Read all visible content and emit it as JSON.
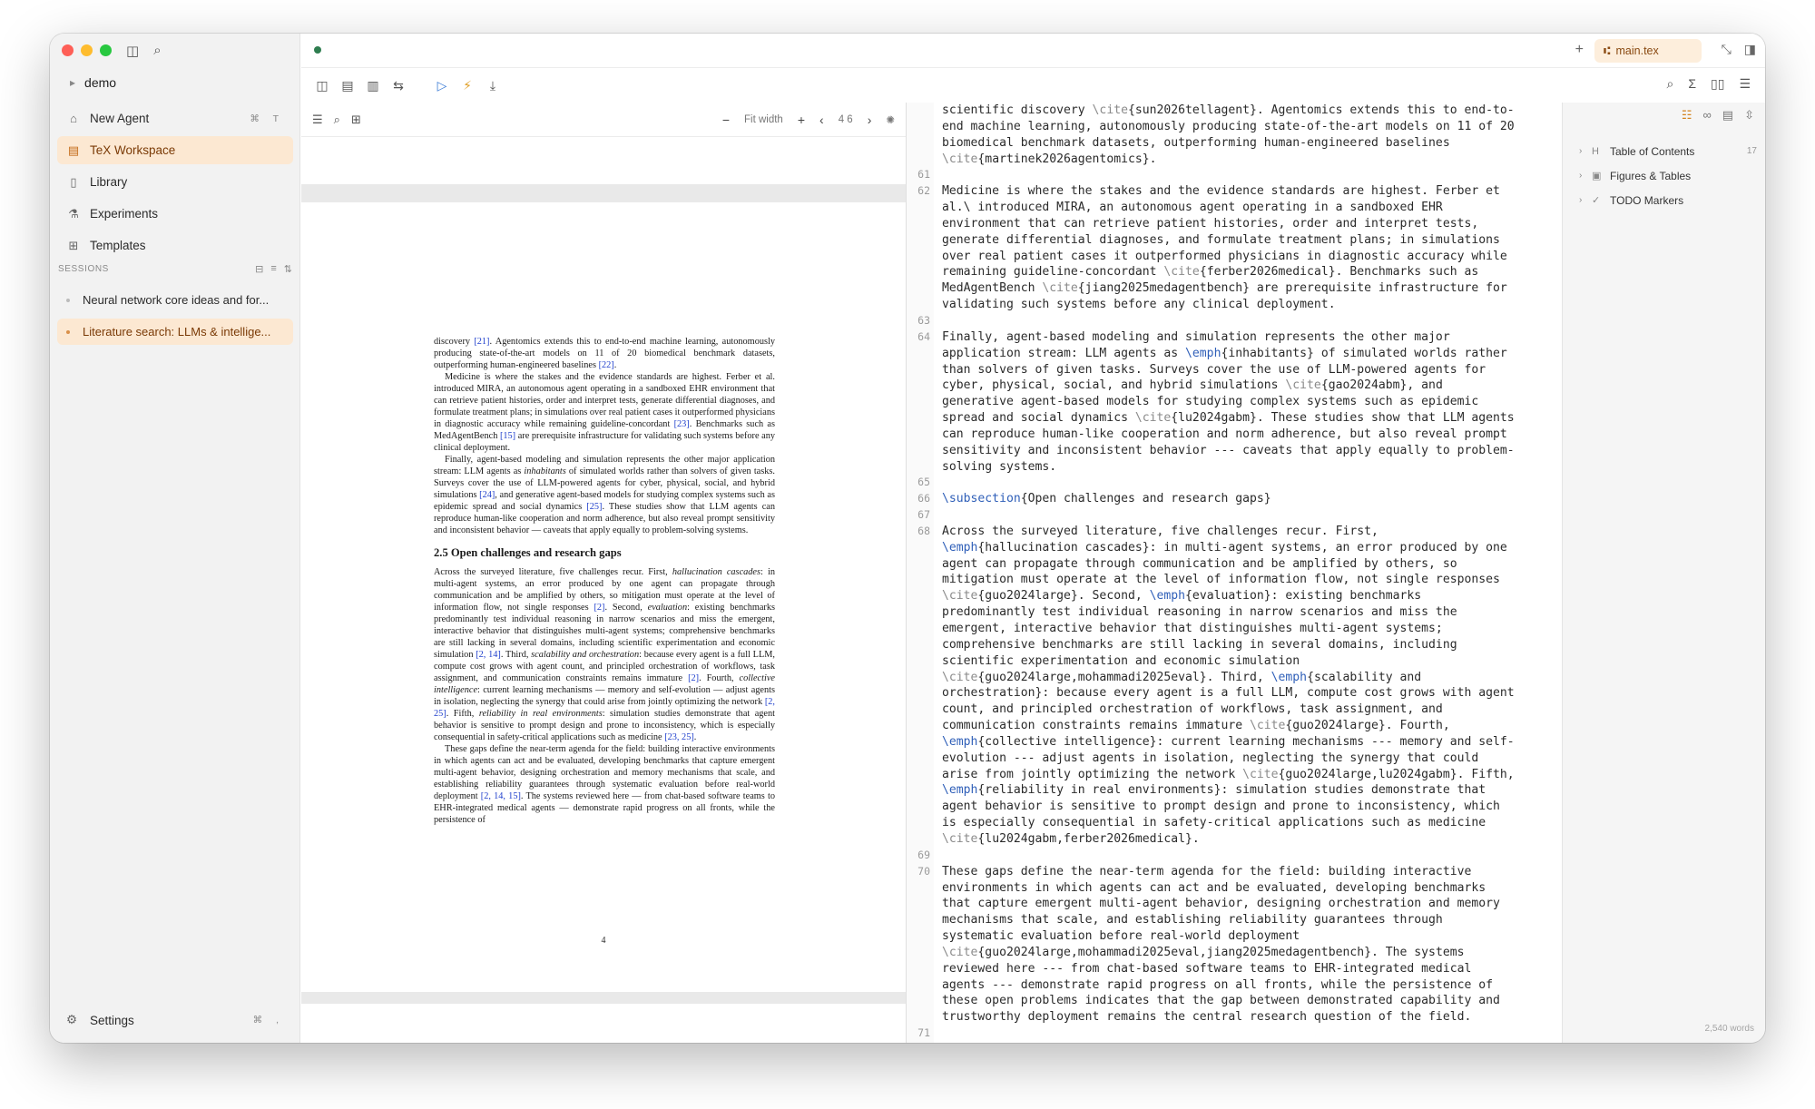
{
  "sidebar": {
    "workspace": "demo",
    "nav": [
      {
        "label": "New Agent",
        "icon": "agent-icon",
        "shortcut": "⌘ T"
      },
      {
        "label": "TeX Workspace",
        "icon": "tex-icon",
        "active": true
      },
      {
        "label": "Library",
        "icon": "library-icon"
      },
      {
        "label": "Experiments",
        "icon": "flask-icon"
      },
      {
        "label": "Templates",
        "icon": "templates-icon"
      }
    ],
    "sessions_header": "SESSIONS",
    "sessions": [
      {
        "label": "Neural network core ideas and for..."
      },
      {
        "label": "Literature search: LLMs & intellige...",
        "active": true
      }
    ],
    "settings_label": "Settings",
    "settings_shortcut": "⌘ ,"
  },
  "titlebar": {
    "file_tab": "main.tex"
  },
  "pdf": {
    "zoom_label": "Fit width",
    "page_indicator": "4 6",
    "page_number": "4",
    "section_heading": "2.5   Open challenges and research gaps"
  },
  "source": {
    "lines": [
      {
        "n": "",
        "t": "scientific discovery \\cite{sun2026tellagent}. Agentomics extends this to end-to-"
      },
      {
        "n": "",
        "t": "end machine learning, autonomously producing state-of-the-art models on 11 of 20"
      },
      {
        "n": "",
        "t": "biomedical benchmark datasets, outperforming human-engineered baselines"
      },
      {
        "n": "",
        "t": "\\cite{martinek2026agentomics}."
      },
      {
        "n": "61",
        "t": ""
      },
      {
        "n": "62",
        "t": "Medicine is where the stakes and the evidence standards are highest. Ferber et"
      },
      {
        "n": "",
        "t": "al.\\ introduced MIRA, an autonomous agent operating in a sandboxed EHR"
      },
      {
        "n": "",
        "t": "environment that can retrieve patient histories, order and interpret tests,"
      },
      {
        "n": "",
        "t": "generate differential diagnoses, and formulate treatment plans; in simulations"
      },
      {
        "n": "",
        "t": "over real patient cases it outperformed physicians in diagnostic accuracy while"
      },
      {
        "n": "",
        "t": "remaining guideline-concordant \\cite{ferber2026medical}. Benchmarks such as"
      },
      {
        "n": "",
        "t": "MedAgentBench \\cite{jiang2025medagentbench} are prerequisite infrastructure for"
      },
      {
        "n": "",
        "t": "validating such systems before any clinical deployment."
      },
      {
        "n": "63",
        "t": ""
      },
      {
        "n": "64",
        "t": "Finally, agent-based modeling and simulation represents the other major"
      },
      {
        "n": "",
        "t": "application stream: LLM agents as \\emph{inhabitants} of simulated worlds rather"
      },
      {
        "n": "",
        "t": "than solvers of given tasks. Surveys cover the use of LLM-powered agents for"
      },
      {
        "n": "",
        "t": "cyber, physical, social, and hybrid simulations \\cite{gao2024abm}, and"
      },
      {
        "n": "",
        "t": "generative agent-based models for studying complex systems such as epidemic"
      },
      {
        "n": "",
        "t": "spread and social dynamics \\cite{lu2024gabm}. These studies show that LLM agents"
      },
      {
        "n": "",
        "t": "can reproduce human-like cooperation and norm adherence, but also reveal prompt"
      },
      {
        "n": "",
        "t": "sensitivity and inconsistent behavior --- caveats that apply equally to problem-"
      },
      {
        "n": "",
        "t": "solving systems."
      },
      {
        "n": "65",
        "t": ""
      },
      {
        "n": "66",
        "t": "\\subsection{Open challenges and research gaps}"
      },
      {
        "n": "67",
        "t": ""
      },
      {
        "n": "68",
        "t": "Across the surveyed literature, five challenges recur. First,"
      },
      {
        "n": "",
        "t": "\\emph{hallucination cascades}: in multi-agent systems, an error produced by one"
      },
      {
        "n": "",
        "t": "agent can propagate through communication and be amplified by others, so"
      },
      {
        "n": "",
        "t": "mitigation must operate at the level of information flow, not single responses"
      },
      {
        "n": "",
        "t": "\\cite{guo2024large}. Second, \\emph{evaluation}: existing benchmarks"
      },
      {
        "n": "",
        "t": "predominantly test individual reasoning in narrow scenarios and miss the"
      },
      {
        "n": "",
        "t": "emergent, interactive behavior that distinguishes multi-agent systems;"
      },
      {
        "n": "",
        "t": "comprehensive benchmarks are still lacking in several domains, including"
      },
      {
        "n": "",
        "t": "scientific experimentation and economic simulation"
      },
      {
        "n": "",
        "t": "\\cite{guo2024large,mohammadi2025eval}. Third, \\emph{scalability and"
      },
      {
        "n": "",
        "t": "orchestration}: because every agent is a full LLM, compute cost grows with agent"
      },
      {
        "n": "",
        "t": "count, and principled orchestration of workflows, task assignment, and"
      },
      {
        "n": "",
        "t": "communication constraints remains immature \\cite{guo2024large}. Fourth,"
      },
      {
        "n": "",
        "t": "\\emph{collective intelligence}: current learning mechanisms --- memory and self-"
      },
      {
        "n": "",
        "t": "evolution --- adjust agents in isolation, neglecting the synergy that could"
      },
      {
        "n": "",
        "t": "arise from jointly optimizing the network \\cite{guo2024large,lu2024gabm}. Fifth,"
      },
      {
        "n": "",
        "t": "\\emph{reliability in real environments}: simulation studies demonstrate that"
      },
      {
        "n": "",
        "t": "agent behavior is sensitive to prompt design and prone to inconsistency, which"
      },
      {
        "n": "",
        "t": "is especially consequential in safety-critical applications such as medicine"
      },
      {
        "n": "",
        "t": "\\cite{lu2024gabm,ferber2026medical}."
      },
      {
        "n": "69",
        "t": ""
      },
      {
        "n": "70",
        "t": "These gaps define the near-term agenda for the field: building interactive"
      },
      {
        "n": "",
        "t": "environments in which agents can act and be evaluated, developing benchmarks"
      },
      {
        "n": "",
        "t": "that capture emergent multi-agent behavior, designing orchestration and memory"
      },
      {
        "n": "",
        "t": "mechanisms that scale, and establishing reliability guarantees through"
      },
      {
        "n": "",
        "t": "systematic evaluation before real-world deployment"
      },
      {
        "n": "",
        "t": "\\cite{guo2024large,mohammadi2025eval,jiang2025medagentbench}. The systems"
      },
      {
        "n": "",
        "t": "reviewed here --- from chat-based software teams to EHR-integrated medical"
      },
      {
        "n": "",
        "t": "agents --- demonstrate rapid progress on all fronts, while the persistence of"
      },
      {
        "n": "",
        "t": "these open problems indicates that the gap between demonstrated capability and"
      },
      {
        "n": "",
        "t": "trustworthy deployment remains the central research question of the field."
      },
      {
        "n": "71",
        "t": ""
      }
    ]
  },
  "outline": {
    "items": [
      {
        "label": "Table of Contents",
        "icon": "heading-icon",
        "count": "17"
      },
      {
        "label": "Figures & Tables",
        "icon": "image-icon",
        "count": ""
      },
      {
        "label": "TODO Markers",
        "icon": "check-icon",
        "count": ""
      }
    ],
    "word_count": "2,540 words"
  },
  "colors": {
    "accent": "#fce8d2",
    "accent_text": "#7a3a06",
    "status": "#2e7d4f",
    "cite_blue": "#1f3fcc"
  }
}
